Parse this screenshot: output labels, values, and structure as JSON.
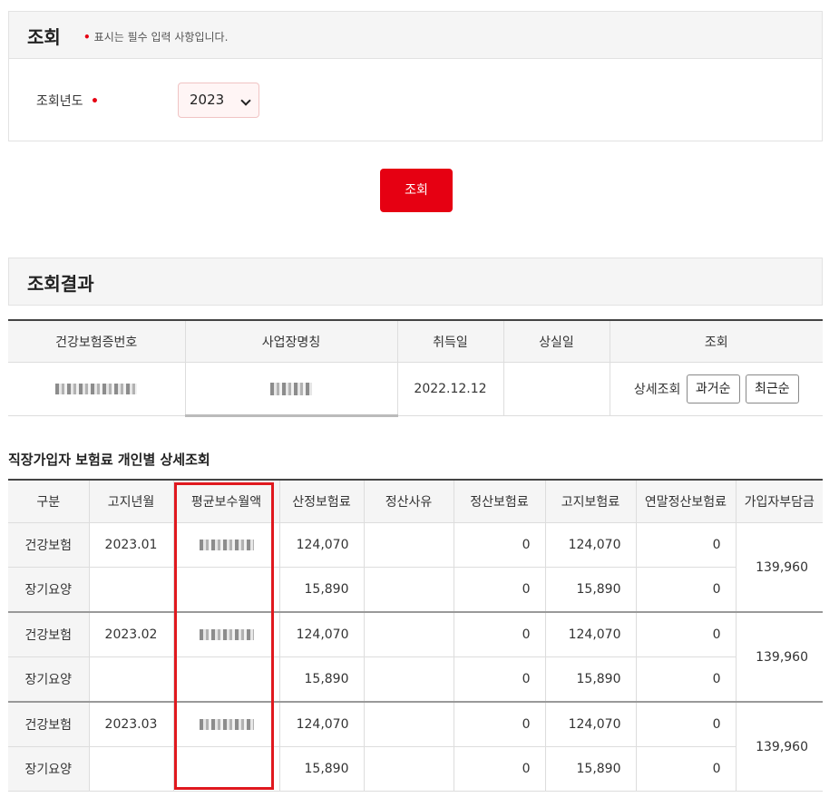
{
  "search": {
    "title": "조회",
    "required_note": "표시는 필수 입력 사항입니다.",
    "year_label": "조회년도",
    "year_value": "2023",
    "button_label": "조회"
  },
  "result": {
    "title": "조회결과",
    "summary_headers": [
      "건강보험증번호",
      "사업장명칭",
      "취득일",
      "상실일",
      "조회"
    ],
    "summary_row": {
      "acquired_date": "2022.12.12",
      "lost_date": "",
      "detail_label": "상세조회",
      "past_order_label": "과거순",
      "recent_order_label": "최근순"
    }
  },
  "detail": {
    "title": "직장가입자 보험료 개인별 상세조회",
    "headers": [
      "구분",
      "고지년월",
      "평균보수월액",
      "산정보험료",
      "정산사유",
      "정산보험료",
      "고지보험료",
      "연말정산보험료",
      "가입자부담금"
    ],
    "groups": [
      {
        "month": "2023.01",
        "burden": "139,960",
        "rows": [
          {
            "type": "건강보험",
            "calc": "124,070",
            "settle_reason": "",
            "settle": "0",
            "notice": "124,070",
            "yearend": "0"
          },
          {
            "type": "장기요양",
            "calc": "15,890",
            "settle_reason": "",
            "settle": "0",
            "notice": "15,890",
            "yearend": "0"
          }
        ]
      },
      {
        "month": "2023.02",
        "burden": "139,960",
        "rows": [
          {
            "type": "건강보험",
            "calc": "124,070",
            "settle_reason": "",
            "settle": "0",
            "notice": "124,070",
            "yearend": "0"
          },
          {
            "type": "장기요양",
            "calc": "15,890",
            "settle_reason": "",
            "settle": "0",
            "notice": "15,890",
            "yearend": "0"
          }
        ]
      },
      {
        "month": "2023.03",
        "burden": "139,960",
        "rows": [
          {
            "type": "건강보험",
            "calc": "124,070",
            "settle_reason": "",
            "settle": "0",
            "notice": "124,070",
            "yearend": "0"
          },
          {
            "type": "장기요양",
            "calc": "15,890",
            "settle_reason": "",
            "settle": "0",
            "notice": "15,890",
            "yearend": "0"
          }
        ]
      }
    ]
  },
  "colors": {
    "accent_red": "#e60012",
    "highlight_red": "#e0181e",
    "header_bg": "#f5f5f5"
  }
}
